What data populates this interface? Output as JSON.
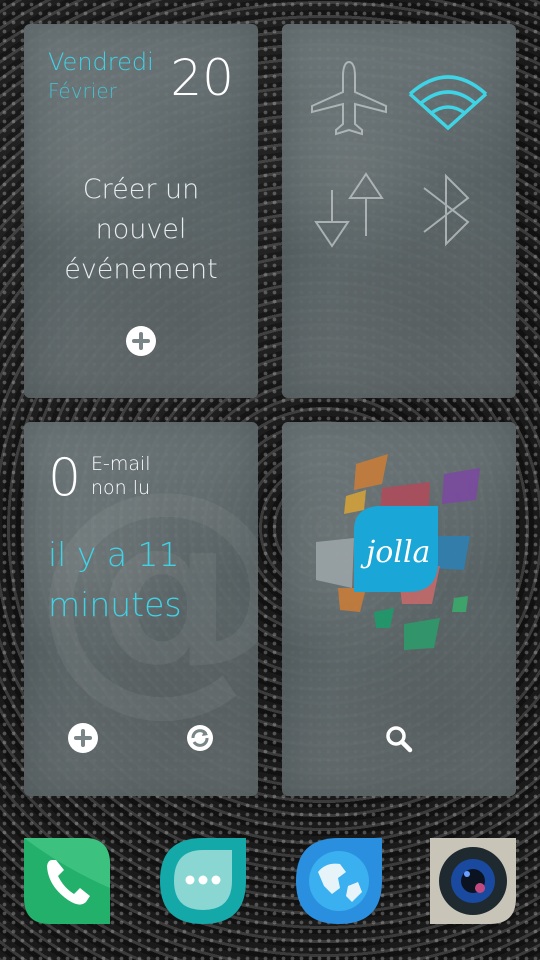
{
  "calendar": {
    "day_name": "Vendredi",
    "month": "Février",
    "date": "20",
    "create_line1": "Créer un",
    "create_line2": "nouvel",
    "create_line3": "événement"
  },
  "settings": {
    "airplane_icon": "airplane-icon",
    "wifi_icon": "wifi-icon",
    "data_icon": "mobile-data-icon",
    "bluetooth_icon": "bluetooth-icon",
    "wifi_active_color": "#3fd3e6"
  },
  "mail": {
    "count": "0",
    "label_line1": "E-mail",
    "label_line2": "non lu",
    "time_line1": "il y a 11",
    "time_line2": "minutes"
  },
  "store": {
    "logo_text": "jolla"
  },
  "dock": {
    "apps": [
      "phone",
      "messages",
      "browser",
      "camera"
    ]
  },
  "colors": {
    "accent": "#3fd3e6"
  }
}
